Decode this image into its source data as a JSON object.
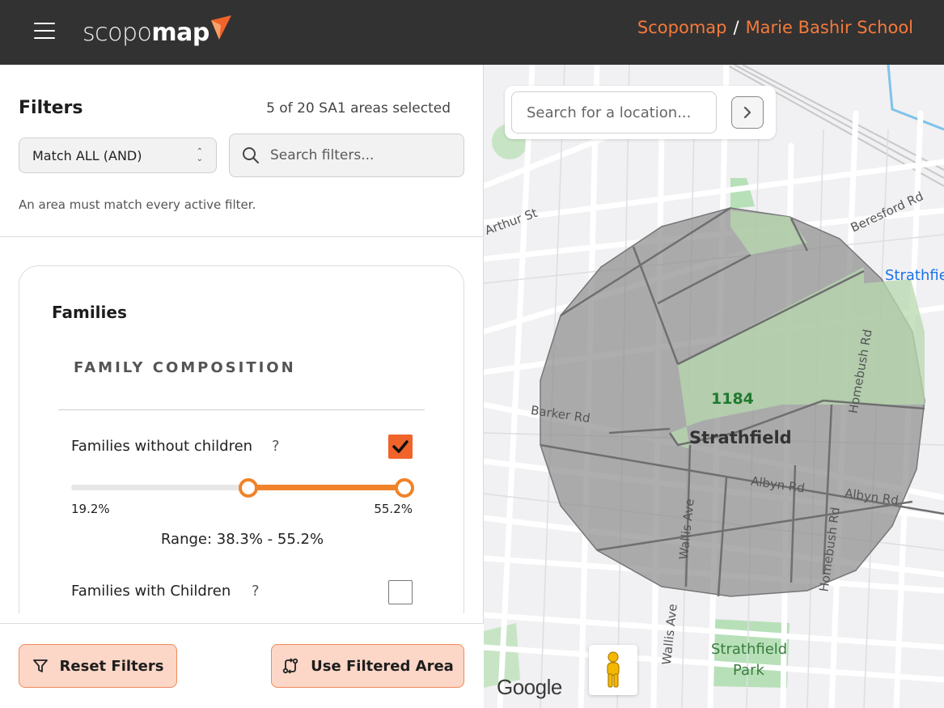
{
  "header": {
    "logo_thin": "scopo",
    "logo_bold": "map",
    "breadcrumb": [
      "Scopomap",
      "Marie Bashir School"
    ],
    "breadcrumb_sep": "/"
  },
  "filters": {
    "title": "Filters",
    "selection_count": "5 of 20 SA1 areas selected",
    "match_mode": "Match ALL (AND)",
    "search_placeholder": "Search filters...",
    "hint": "An area must match every active filter."
  },
  "card": {
    "title": "Families",
    "section_heading": "FAMILY COMPOSITION",
    "items": [
      {
        "label": "Families without children",
        "help": "?",
        "checked": true,
        "min_label": "19.2%",
        "max_label": "55.2%",
        "range_text": "Range: 38.3% - 55.2%",
        "range_min": 38.3,
        "range_max": 55.2,
        "bound_min": 19.2,
        "bound_max": 55.2
      },
      {
        "label": "Families with Children",
        "help": "?",
        "checked": false
      }
    ]
  },
  "actions": {
    "reset_label": "Reset Filters",
    "use_label": "Use Filtered Area"
  },
  "map": {
    "search_placeholder": "Search for a location...",
    "area_id": "1184",
    "suburb": "Strathfield",
    "streets": [
      "Arthur St",
      "Beresford Rd",
      "Barker Rd",
      "Albyn Rd",
      "Albyn Rd",
      "Homebush Rd",
      "Homebush Rd",
      "Wallis Ave",
      "Wallis Ave"
    ],
    "place_labels": [
      "Strathfie",
      "Strathfield",
      "Park"
    ],
    "attribution": "Google",
    "colors": {
      "overlay": "#8c8c8c",
      "park": "#b7e0b8",
      "accent": "#f0632a"
    }
  }
}
